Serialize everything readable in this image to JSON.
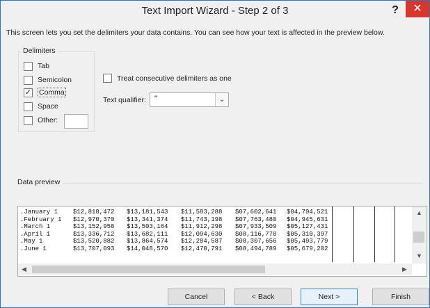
{
  "window": {
    "title": "Text Import Wizard - Step 2 of 3",
    "help": "?",
    "close": "✕"
  },
  "intro": "This screen lets you set the delimiters your data contains.  You can see how your text is affected in the preview below.",
  "delimiters": {
    "title": "Delimiters",
    "tab": "Tab",
    "semicolon": "Semicolon",
    "comma": "Comma",
    "space": "Space",
    "other": "Other:",
    "other_value": ""
  },
  "options": {
    "consecutive": "Treat consecutive delimiters as one"
  },
  "qualifier": {
    "label": "Text qualifier:",
    "value": "\""
  },
  "preview": {
    "title": "Data preview",
    "rows": [
      [
        ".January 1",
        "$12,818,472",
        "$13,181,543",
        "$11,583,288",
        "$07,602,641",
        "$04,794,521"
      ],
      [
        ".February 1",
        "$12,970,370",
        "$13,341,374",
        "$11,743,198",
        "$07,763,480",
        "$04,945,631"
      ],
      [
        ".March 1",
        "$13,152,958",
        "$13,503,164",
        "$11,912,298",
        "$07,933,509",
        "$05,127,431"
      ],
      [
        ".April 1",
        "$13,336,712",
        "$13,682,111",
        "$12,094,630",
        "$08,116,770",
        "$05,310,397"
      ],
      [
        ".May 1",
        "$13,520,882",
        "$13,864,574",
        "$12,284,587",
        "$08,307,656",
        "$05,493,779"
      ],
      [
        ".June 1",
        "$13,707,093",
        "$14,048,570",
        "$12,470,791",
        "$08,494,789",
        "$05,679,202"
      ]
    ]
  },
  "buttons": {
    "cancel": "Cancel",
    "back": "< Back",
    "next": "Next >",
    "finish": "Finish"
  },
  "colors": {
    "close_bg": "#d9362b",
    "border": "#2b75c4",
    "default_button": "#e5f1fb"
  }
}
